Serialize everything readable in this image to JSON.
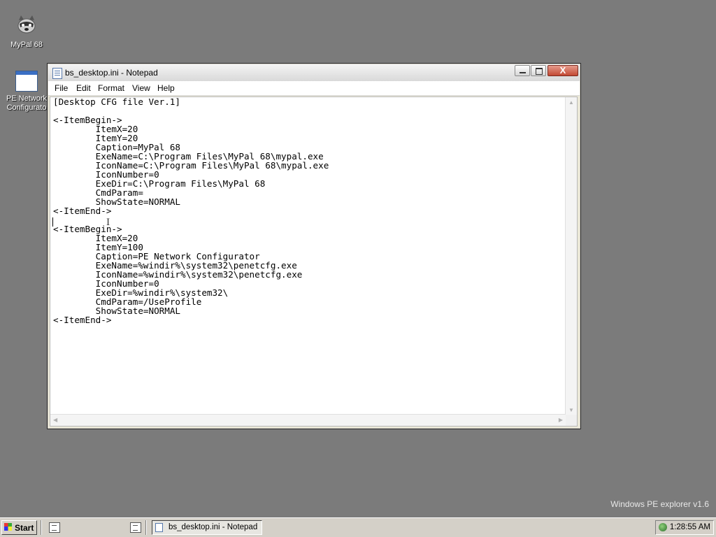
{
  "desktop": {
    "icons": [
      {
        "label": "MyPal 68"
      },
      {
        "label": "PE Network Configurato"
      }
    ],
    "watermark": "Windows PE explorer v1.6"
  },
  "window": {
    "title": "bs_desktop.ini - Notepad",
    "close_symbol": "X",
    "menu": [
      "File",
      "Edit",
      "Format",
      "View",
      "Help"
    ],
    "content": "[Desktop CFG file Ver.1]\n\n<-ItemBegin->\n\tItemX=20\n\tItemY=20\n\tCaption=MyPal 68\n\tExeName=C:\\Program Files\\MyPal 68\\mypal.exe\n\tIconName=C:\\Program Files\\MyPal 68\\mypal.exe\n\tIconNumber=0\n\tExeDir=C:\\Program Files\\MyPal 68\n\tCmdParam=\n\tShowState=NORMAL\n<-ItemEnd->\n\n<-ItemBegin->\n\tItemX=20\n\tItemY=100\n\tCaption=PE Network Configurator\n\tExeName=%windir%\\system32\\penetcfg.exe\n\tIconName=%windir%\\system32\\penetcfg.exe\n\tIconNumber=0\n\tExeDir=%windir%\\system32\\\n\tCmdParam=/UseProfile\n\tShowState=NORMAL\n<-ItemEnd->"
  },
  "taskbar": {
    "start_label": "Start",
    "task_label": "bs_desktop.ini - Notepad",
    "clock": "1:28:55 AM"
  }
}
